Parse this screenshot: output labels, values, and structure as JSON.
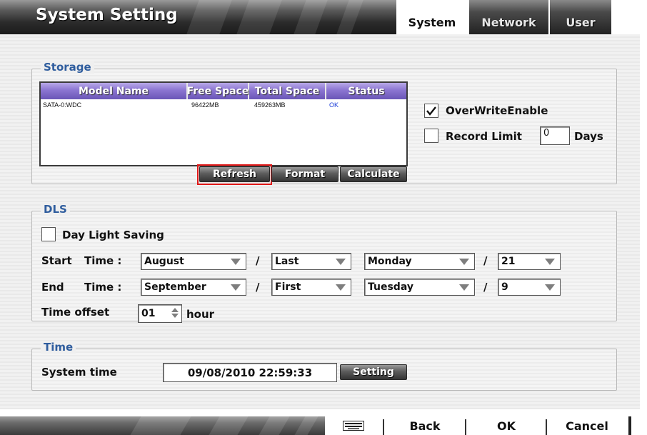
{
  "header": {
    "title": "System Setting",
    "tabs": [
      {
        "label": "System",
        "active": true
      },
      {
        "label": "Network",
        "active": false
      },
      {
        "label": "User",
        "active": false
      }
    ]
  },
  "storage": {
    "legend": "Storage",
    "columns": [
      "Model Name",
      "Free Space",
      "Total Space",
      "Status"
    ],
    "rows": [
      {
        "model": "SATA-0:WDC",
        "free": "96422MB",
        "total": "459263MB",
        "status": "OK"
      }
    ],
    "buttons": {
      "refresh": "Refresh",
      "format": "Format",
      "calculate": "Calculate"
    },
    "overwrite": {
      "label": "OverWriteEnable",
      "checked": true
    },
    "record_limit": {
      "label": "Record Limit",
      "value": "0",
      "unit": "Days",
      "checked": false
    }
  },
  "dls": {
    "legend": "DLS",
    "day_light_saving": {
      "label": "Day Light Saving",
      "checked": false
    },
    "start": {
      "label_a": "Start",
      "label_b": "Time :",
      "month": "August",
      "week": "Last",
      "weekday": "Monday",
      "hour": "21"
    },
    "end": {
      "label_a": "End",
      "label_b": "Time :",
      "month": "September",
      "week": "First",
      "weekday": "Tuesday",
      "hour": "9"
    },
    "separator": "/",
    "offset": {
      "label": "Time offset",
      "value": "01",
      "unit": "hour"
    }
  },
  "time": {
    "legend": "Time",
    "label": "System time",
    "value": "09/08/2010 22:59:33",
    "setting_button": "Setting"
  },
  "footer": {
    "keyboard_icon": "keyboard-icon",
    "back": "Back",
    "ok": "OK",
    "cancel": "Cancel"
  },
  "colors": {
    "legend_text": "#2f5d9e",
    "table_header": "#7b66c4",
    "status_ok": "#1a3cd8",
    "highlight": "#e01818"
  }
}
